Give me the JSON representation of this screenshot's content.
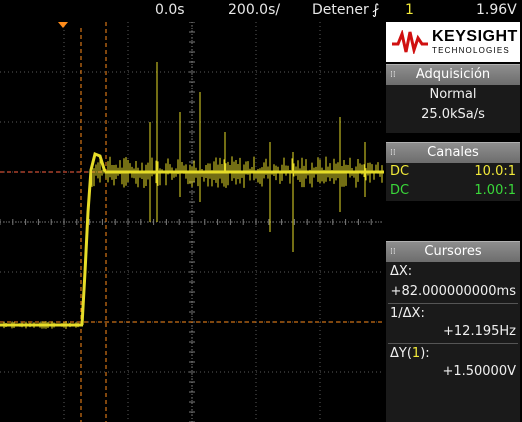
{
  "status": {
    "marker": "0.0s",
    "time_scale": "200.0s/",
    "run_state": "Detener",
    "trigger_icon": "trigger-edge-icon",
    "trigger_channel": "1",
    "trigger_level": "1.96V"
  },
  "brand": {
    "name": "KEYSIGHT",
    "sub": "TECHNOLOGIES"
  },
  "acquisition": {
    "title": "Adquisición",
    "mode": "Normal",
    "rate": "25.0kSa/s"
  },
  "channels": {
    "title": "Canales",
    "items": [
      {
        "coupling": "DC",
        "ratio": "10.0:1",
        "color": "#f2ea3a"
      },
      {
        "coupling": "DC",
        "ratio": "1.00:1",
        "color": "#3ad83a"
      }
    ]
  },
  "cursors": {
    "title": "Cursores",
    "dx_label": "ΔX:",
    "dx_value": "+82.000000000ms",
    "inv_label": "1/ΔX:",
    "inv_value": "+12.195Hz",
    "dy_label_prefix": "ΔY(",
    "dy_channel": "1",
    "dy_label_suffix": "):",
    "dy_value": "+1.50000V"
  },
  "colors": {
    "trace": "#e6dc28",
    "cursor": "#ff8c1a",
    "grid": "#5a5a5a",
    "accent_red": "#d01010"
  }
}
